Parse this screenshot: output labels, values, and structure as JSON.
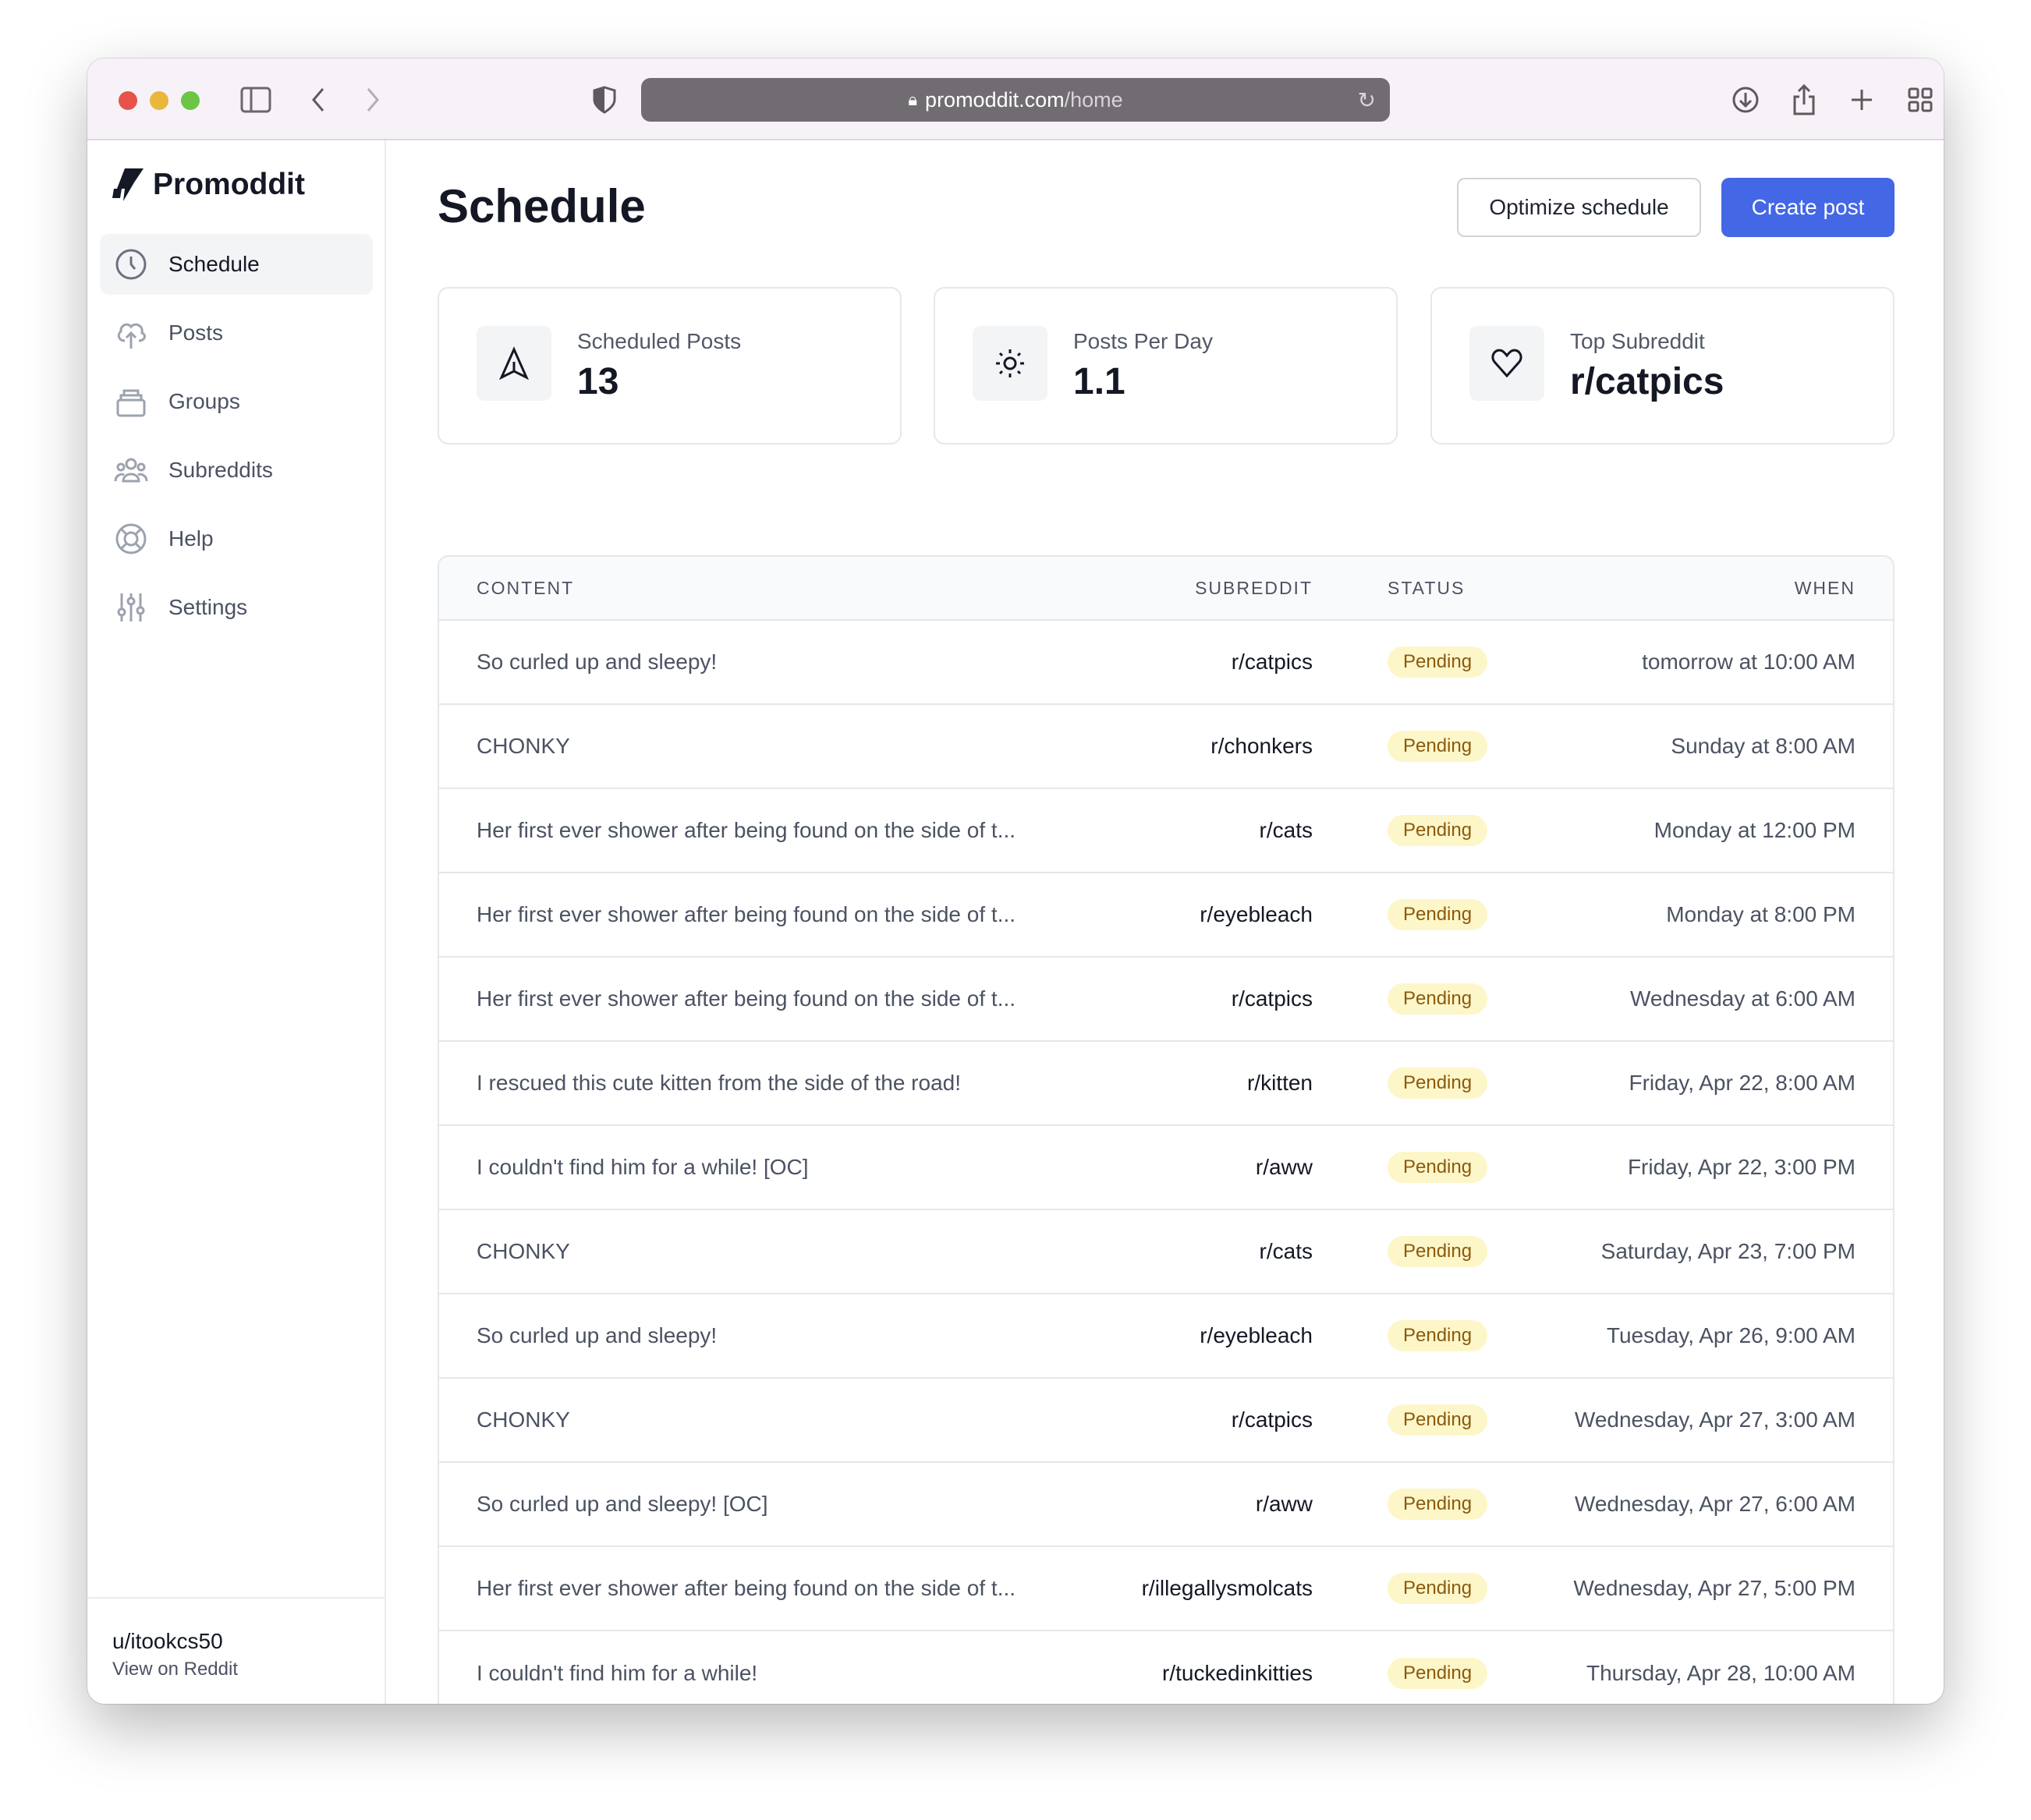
{
  "browser": {
    "url_host": "promoddit.com",
    "url_path": "/home",
    "colors": {
      "close": "#e5534b",
      "minimize": "#e9b73c",
      "maximize": "#6cc644"
    }
  },
  "app": {
    "name": "Promoddit",
    "accent": "#4467e6"
  },
  "sidebar": {
    "items": [
      {
        "label": "Schedule",
        "icon": "clock-icon",
        "active": true
      },
      {
        "label": "Posts",
        "icon": "cloud-upload-icon"
      },
      {
        "label": "Groups",
        "icon": "stack-icon"
      },
      {
        "label": "Subreddits",
        "icon": "users-icon"
      },
      {
        "label": "Help",
        "icon": "lifebuoy-icon"
      },
      {
        "label": "Settings",
        "icon": "sliders-icon"
      }
    ],
    "user": {
      "name": "u/itookcs50",
      "link": "View on Reddit"
    }
  },
  "header": {
    "title": "Schedule",
    "optimize_label": "Optimize schedule",
    "create_label": "Create post"
  },
  "stats": [
    {
      "label": "Scheduled Posts",
      "value": "13",
      "icon": "paper-plane-icon"
    },
    {
      "label": "Posts Per Day",
      "value": "1.1",
      "icon": "sun-icon"
    },
    {
      "label": "Top Subreddit",
      "value": "r/catpics",
      "icon": "heart-icon"
    }
  ],
  "table": {
    "columns": [
      "CONTENT",
      "SUBREDDIT",
      "STATUS",
      "WHEN"
    ],
    "rows": [
      {
        "content": "So curled up and sleepy!",
        "subreddit": "r/catpics",
        "status": "Pending",
        "when": "tomorrow at 10:00 AM"
      },
      {
        "content": "CHONKY",
        "subreddit": "r/chonkers",
        "status": "Pending",
        "when": "Sunday at 8:00 AM"
      },
      {
        "content": "Her first ever shower after being found on the side of t...",
        "subreddit": "r/cats",
        "status": "Pending",
        "when": "Monday at 12:00 PM"
      },
      {
        "content": "Her first ever shower after being found on the side of t...",
        "subreddit": "r/eyebleach",
        "status": "Pending",
        "when": "Monday at 8:00 PM"
      },
      {
        "content": "Her first ever shower after being found on the side of t...",
        "subreddit": "r/catpics",
        "status": "Pending",
        "when": "Wednesday at 6:00 AM"
      },
      {
        "content": "I rescued this cute kitten from the side of the road!",
        "subreddit": "r/kitten",
        "status": "Pending",
        "when": "Friday, Apr 22, 8:00 AM"
      },
      {
        "content": "I couldn't find him for a while! [OC]",
        "subreddit": "r/aww",
        "status": "Pending",
        "when": "Friday, Apr 22, 3:00 PM"
      },
      {
        "content": "CHONKY",
        "subreddit": "r/cats",
        "status": "Pending",
        "when": "Saturday, Apr 23, 7:00 PM"
      },
      {
        "content": "So curled up and sleepy!",
        "subreddit": "r/eyebleach",
        "status": "Pending",
        "when": "Tuesday, Apr 26, 9:00 AM"
      },
      {
        "content": "CHONKY",
        "subreddit": "r/catpics",
        "status": "Pending",
        "when": "Wednesday, Apr 27, 3:00 AM"
      },
      {
        "content": "So curled up and sleepy! [OC]",
        "subreddit": "r/aww",
        "status": "Pending",
        "when": "Wednesday, Apr 27, 6:00 AM"
      },
      {
        "content": "Her first ever shower after being found on the side of t...",
        "subreddit": "r/illegallysmolcats",
        "status": "Pending",
        "when": "Wednesday, Apr 27, 5:00 PM"
      },
      {
        "content": "I couldn't find him for a while!",
        "subreddit": "r/tuckedinkitties",
        "status": "Pending",
        "when": "Thursday, Apr 28, 10:00 AM"
      }
    ]
  }
}
